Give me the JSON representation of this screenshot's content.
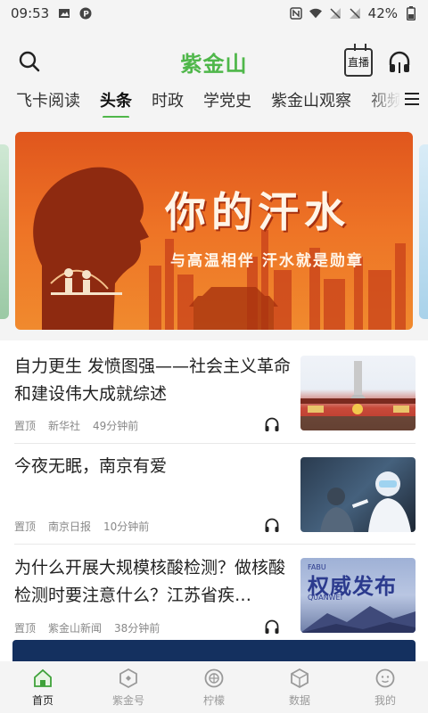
{
  "status_bar": {
    "time": "09:53",
    "battery": "42%"
  },
  "header": {
    "logo_text": "紫金山",
    "live_label": "直播"
  },
  "tabs": [
    {
      "label": "飞卡阅读"
    },
    {
      "label": "头条"
    },
    {
      "label": "时政"
    },
    {
      "label": "学党史"
    },
    {
      "label": "紫金山观察"
    },
    {
      "label": "视频"
    }
  ],
  "banner": {
    "title": "你的汗水",
    "subtitle": "与高温相伴  汗水就是勋章"
  },
  "news": [
    {
      "title": "自力更生  发愤图强——社会主义革命和建设伟大成就综述",
      "tag": "置顶",
      "source": "新华社",
      "time": "49分钟前"
    },
    {
      "title": "今夜无眠，南京有爱",
      "tag": "置顶",
      "source": "南京日报",
      "time": "10分钟前"
    },
    {
      "title": "为什么开展大规模核酸检测？做核酸检测时要注意什么？江苏省疾…",
      "tag": "置顶",
      "source": "紫金山新闻",
      "time": "38分钟前",
      "thumb_text": "权威发布",
      "thumb_small_top": "FABU",
      "thumb_small_bottom": "QUANWEI"
    }
  ],
  "bottom_nav": [
    {
      "label": "首页",
      "icon": "home-icon"
    },
    {
      "label": "紫金号",
      "icon": "zijinhao-icon"
    },
    {
      "label": "柠檬",
      "icon": "lemon-icon"
    },
    {
      "label": "数据",
      "icon": "data-icon"
    },
    {
      "label": "我的",
      "icon": "profile-icon"
    }
  ],
  "colors": {
    "accent": "#4fb74a",
    "banner_orange": "#e9601f"
  }
}
